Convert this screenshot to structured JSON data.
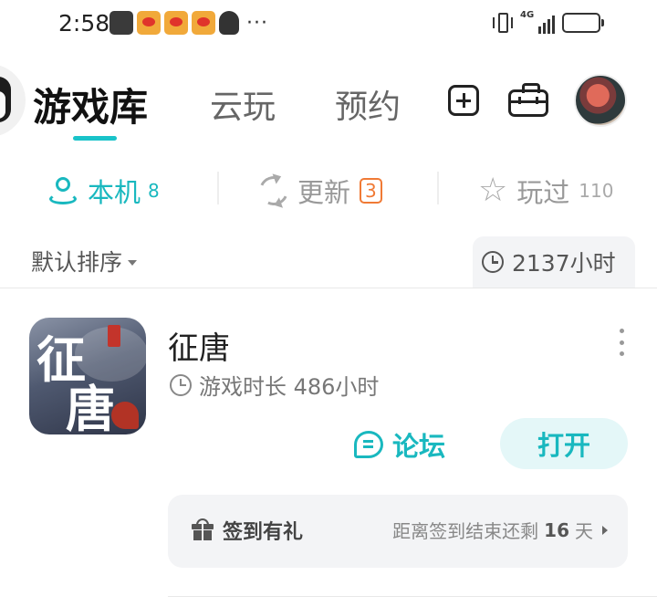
{
  "status_bar": {
    "time": "2:58",
    "notification_icons": [
      "game-controller-icon",
      "weibo-icon",
      "weibo-icon",
      "weibo-icon",
      "qq-icon"
    ],
    "more_notifications": "···",
    "network_label": "4G",
    "battery_level": 0.7
  },
  "header": {
    "tabs": [
      {
        "label": "游戏库",
        "active": true
      },
      {
        "label": "云玩",
        "active": false
      },
      {
        "label": "预约",
        "active": false
      }
    ],
    "actions": [
      "add-icon",
      "toolbox-icon"
    ]
  },
  "subtabs": {
    "local": {
      "label": "本机",
      "count": "8",
      "icon": "local-device-icon"
    },
    "update": {
      "label": "更新",
      "count": "3",
      "icon": "refresh-icon"
    },
    "played": {
      "label": "玩过",
      "count": "110",
      "icon": "star-icon"
    }
  },
  "sort": {
    "label": "默认排序",
    "total_time": "2137小时"
  },
  "games": [
    {
      "name": "征唐",
      "play_time": "游戏时长 486小时",
      "icon_glyphs": [
        "征",
        "唐"
      ],
      "forum_label": "论坛",
      "open_label": "打开",
      "checkin": {
        "label": "签到有礼",
        "remain_prefix": "距离签到结束还剩",
        "remain_days": "16",
        "remain_unit": "天"
      }
    }
  ],
  "colors": {
    "accent": "#19b8bf",
    "update_badge": "#f07a35"
  }
}
